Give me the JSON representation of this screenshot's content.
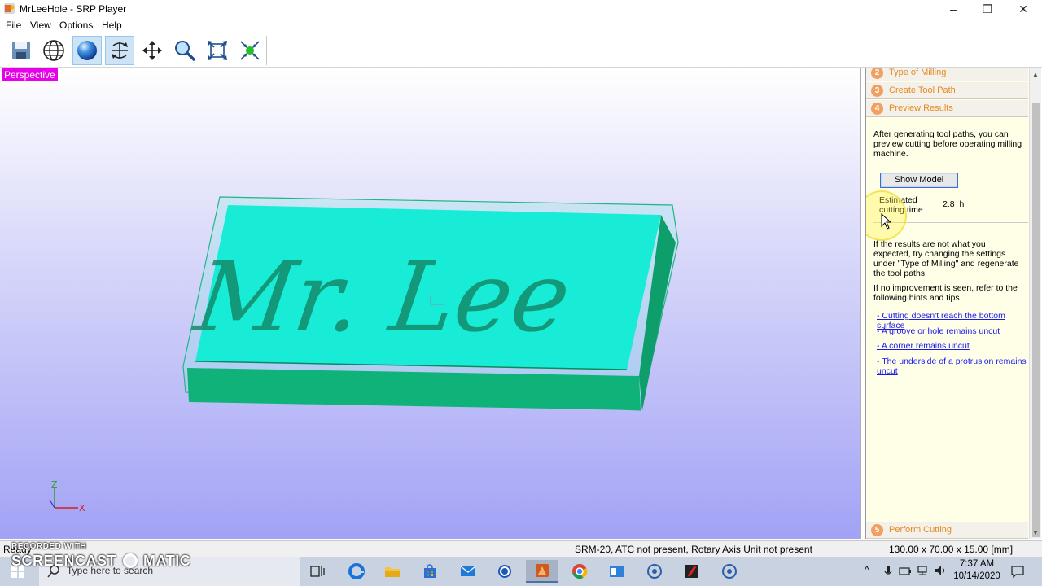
{
  "window": {
    "title": "MrLeeHole - SRP Player",
    "minimize": "–",
    "restore": "❐",
    "close": "✕"
  },
  "menu": {
    "file": "File",
    "view": "View",
    "options": "Options",
    "help": "Help"
  },
  "toolbar": {
    "items": [
      "save-icon",
      "wireframe-globe-icon",
      "render-sphere-icon",
      "rotate-icon",
      "pan-icon",
      "zoom-icon",
      "fit-extents-icon",
      "center-icon"
    ],
    "active": [
      "render-sphere-icon",
      "rotate-icon"
    ]
  },
  "viewport": {
    "label": "Perspective",
    "model_text": "Mr. Lee",
    "axis": {
      "z": "Z",
      "x": "X"
    },
    "colors": {
      "model_top": "#19ecd6",
      "model_side": "#0fb37a",
      "label_bg": "#e800e8"
    }
  },
  "panel": {
    "steps": {
      "type_of_milling": {
        "num": "2",
        "label": "Type of Milling"
      },
      "create_tool_path": {
        "num": "3",
        "label": "Create Tool Path"
      },
      "preview_results": {
        "num": "4",
        "label": "Preview Results"
      },
      "perform_cutting": {
        "num": "5",
        "label": "Perform Cutting"
      }
    },
    "intro": "After generating tool paths, you can preview cutting before operating milling machine.",
    "show_model": "Show Model",
    "estimated_label_1": "Estimated",
    "estimated_label_2": "cutting time",
    "estimated_value": "2.8",
    "estimated_unit": "h",
    "hint_1": "If the results are not what you expected, try changing the settings under \"Type of Milling\" and regenerate the tool paths.",
    "hint_2": "If no improvement is seen, refer to the following hints and tips.",
    "links": [
      "- Cutting doesn't reach the bottom surface",
      "- A groove or hole remains uncut",
      "- A corner remains uncut",
      "- The underside of a protrusion remains uncut"
    ]
  },
  "status": {
    "ready": "Ready",
    "machine": "SRM-20, ATC not present, Rotary Axis Unit not present",
    "dimensions": "130.00 x  70.00 x  15.00 [mm]"
  },
  "taskbar": {
    "search_placeholder": "Type here to search",
    "time": "7:37 AM",
    "date": "10/14/2020"
  },
  "watermark": {
    "line1": "RECORDED WITH",
    "line2": "SCREENCAST",
    "line3": "MATIC"
  }
}
